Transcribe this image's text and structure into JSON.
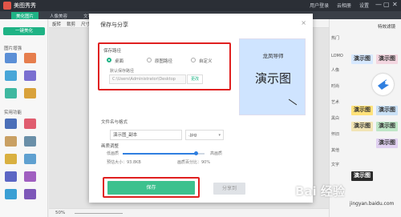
{
  "app": {
    "title": "美图秀秀",
    "window_controls": [
      "—",
      "▢",
      "✕"
    ]
  },
  "topbar": {
    "items": [
      "用户登录",
      "云相册",
      "设置"
    ]
  },
  "tabs": [
    {
      "label": "美化图片",
      "active": true
    },
    {
      "label": "人像美容",
      "active": false
    },
    {
      "label": "文字",
      "active": false
    }
  ],
  "left_panel": {
    "button_label": "一键美化",
    "section1": "图片增强",
    "section2": "实用功能"
  },
  "canvas_toolbar": {
    "items": [
      "旋转",
      "裁剪",
      "尺寸"
    ]
  },
  "statusbar": {
    "zoom": "50%"
  },
  "right_panel": {
    "title": "特效滤镜",
    "labels": [
      "热门",
      "LOMO",
      "人像",
      "时尚",
      "艺术",
      "黑白",
      "怀旧",
      "其他",
      "文字"
    ],
    "samples": [
      "演示图",
      "演示图",
      "演示图",
      "演示图",
      "演示图",
      "演示图",
      "演示图",
      "演示图"
    ]
  },
  "dialog": {
    "title": "保存与分享",
    "close": "×",
    "save_path": {
      "label": "保存路径",
      "options": [
        "桌面",
        "原图路径",
        "自定义"
      ],
      "selected": "桌面",
      "hint": "默认保存路径",
      "path": "C:\\Users\\Administrator\\Desktop",
      "change_label": "更改"
    },
    "file": {
      "label": "文件名与格式",
      "name": "演示图_副本",
      "format": ".jpg"
    },
    "quality": {
      "label": "画质调整",
      "low": "低画质",
      "high": "高画质",
      "size_text": "预估大小：93.8KB",
      "percent_text": "画质百分比：90%",
      "percent": 0.9
    },
    "save_label": "保存",
    "share_label": "分享到",
    "preview": {
      "subtitle": "龙凤导师",
      "main": "演示图"
    }
  },
  "watermark": {
    "brand": "Bai 经验",
    "url": "jingyan.baidu.com"
  },
  "colors": {
    "accent": "#1fb385",
    "save_button": "#3cc18e",
    "highlight": "#e02020",
    "slider": "#2f7fe0"
  }
}
